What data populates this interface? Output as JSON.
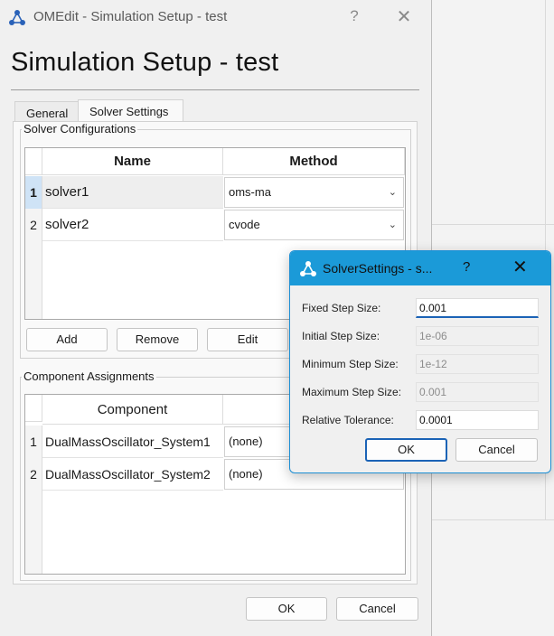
{
  "window": {
    "title": "OMEdit - Simulation Setup - test",
    "help_glyph": "?",
    "close_glyph": "✕"
  },
  "dialog_heading": "Simulation Setup - test",
  "tabs": [
    {
      "label": "General",
      "active": false
    },
    {
      "label": "Solver Settings",
      "active": true
    }
  ],
  "solver_configurations": {
    "group_label": "Solver Configurations",
    "columns": [
      "Name",
      "Method"
    ],
    "rows": [
      {
        "num": "1",
        "name": "solver1",
        "method": "oms-ma",
        "selected": true
      },
      {
        "num": "2",
        "name": "solver2",
        "method": "cvode",
        "selected": false
      }
    ],
    "buttons": {
      "add": "Add",
      "remove": "Remove",
      "edit": "Edit"
    }
  },
  "component_assignments": {
    "group_label": "Component Assignments",
    "columns": [
      "Component"
    ],
    "rows": [
      {
        "num": "1",
        "component": "DualMassOscillator_System1",
        "solver": "(none)"
      },
      {
        "num": "2",
        "component": "DualMassOscillator_System2",
        "solver": "(none)"
      }
    ]
  },
  "footer": {
    "ok": "OK",
    "cancel": "Cancel"
  },
  "solver_settings_dialog": {
    "title": "SolverSettings - s...",
    "help_glyph": "?",
    "close_glyph": "✕",
    "fields": [
      {
        "label": "Fixed Step Size:",
        "value": "0.001",
        "enabled": true
      },
      {
        "label": "Initial Step Size:",
        "value": "1e-06",
        "enabled": false
      },
      {
        "label": "Minimum Step Size:",
        "value": "1e-12",
        "enabled": false
      },
      {
        "label": "Maximum Step Size:",
        "value": "0.001",
        "enabled": false
      },
      {
        "label": "Relative Tolerance:",
        "value": "0.0001",
        "enabled": true
      }
    ],
    "ok": "OK",
    "cancel": "Cancel"
  },
  "colors": {
    "accent": "#1b9ad8",
    "selection": "#cfe3f6"
  },
  "icons": [
    "omedit-app-icon",
    "chevron-down-icon",
    "help-icon",
    "close-icon"
  ]
}
